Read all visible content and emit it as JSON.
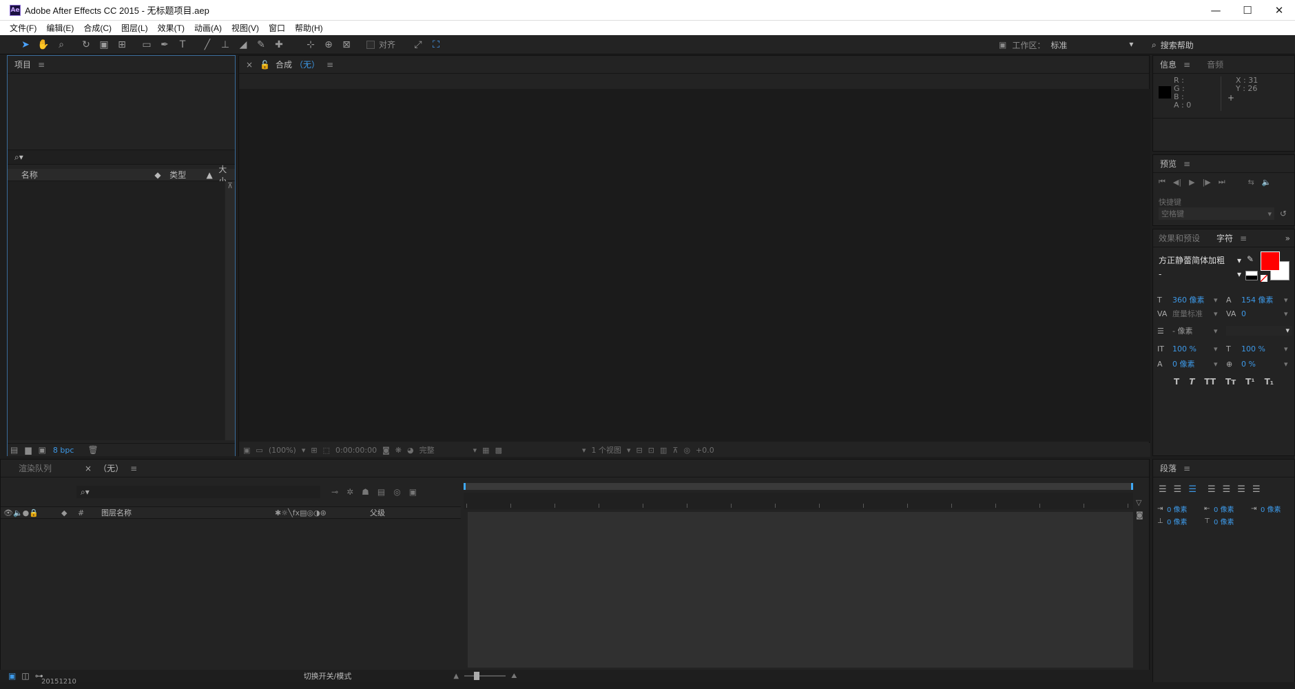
{
  "window": {
    "title": "Adobe After Effects CC 2015 - 无标题项目.aep",
    "logo_text": "Ae",
    "minimize": "—",
    "maximize": "☐",
    "close": "✕"
  },
  "menu": [
    "文件(F)",
    "编辑(E)",
    "合成(C)",
    "图层(L)",
    "效果(T)",
    "动画(A)",
    "视图(V)",
    "窗口",
    "帮助(H)"
  ],
  "toolbar": {
    "snap_label": "对齐",
    "workspace_label": "工作区：",
    "workspace_value": "标准",
    "search_help": "搜索帮助"
  },
  "project": {
    "tab": "项目",
    "col_name": "名称",
    "col_type": "类型",
    "col_size": "大小",
    "bpc": "8 bpc"
  },
  "comp": {
    "tab": "合成",
    "tab_value": "（无）",
    "zoom": "(100%)",
    "timecode": "0:00:00:00",
    "resolution": "完整",
    "views": "1 个视图",
    "exposure": "+0.0"
  },
  "info": {
    "tab_info": "信息",
    "tab_audio": "音频",
    "r": "R :",
    "g": "G :",
    "b": "B :",
    "a": "A : 0",
    "x": "X : 31",
    "y": "Y : 26"
  },
  "preview": {
    "tab": "预览",
    "shortcut_label": "快捷键",
    "shortcut_value": "空格键"
  },
  "character": {
    "tab_effects": "效果和预设",
    "tab_char": "字符",
    "font_family": "方正静蕾简体加粗",
    "font_style": "-",
    "font_size": "360 像素",
    "leading": "154 像素",
    "kerning": "度量标准",
    "tracking": "0",
    "stroke_width": "- 像素",
    "vscale": "100 %",
    "hscale": "100 %",
    "baseline": "0 像素",
    "tsume": "0 %",
    "styles": [
      "T",
      "T",
      "TT",
      "Tт",
      "T¹",
      "T₁"
    ],
    "fill_color": "#ff0000"
  },
  "timeline": {
    "tab_render": "渲染队列",
    "tab_comp": "（无）",
    "col_hash": "#",
    "col_layer": "图层名称",
    "col_parent": "父级",
    "switches": "切换开关/模式",
    "date_fragment": "20151210"
  },
  "paragraph": {
    "tab": "段落",
    "indent_left": "0 像素",
    "indent_right": "0 像素",
    "indent_first": "0 像素",
    "space_before": "0 像素",
    "space_after": "0 像素"
  }
}
